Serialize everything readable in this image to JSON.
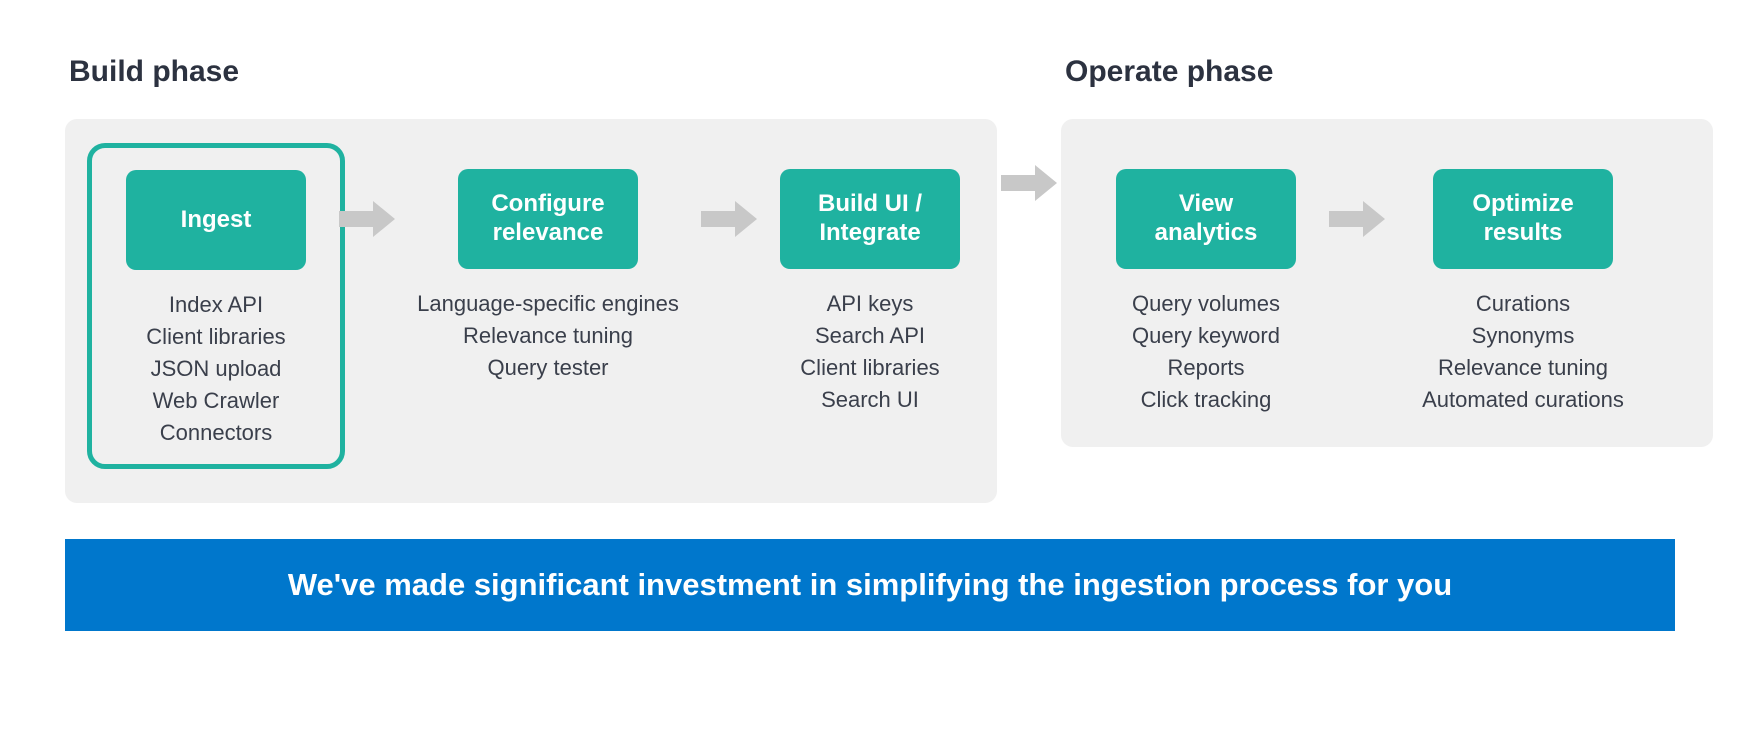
{
  "phases": {
    "build": {
      "title": "Build phase",
      "steps": [
        {
          "label": "Ingest",
          "highlighted": true,
          "items": [
            "Index API",
            "Client libraries",
            "JSON upload",
            "Web Crawler",
            "Connectors"
          ]
        },
        {
          "label": "Configure relevance",
          "highlighted": false,
          "items": [
            "Language-specific engines",
            "Relevance tuning",
            "Query tester"
          ]
        },
        {
          "label": "Build UI / Integrate",
          "highlighted": false,
          "items": [
            "API keys",
            "Search API",
            "Client libraries",
            "Search UI"
          ]
        }
      ]
    },
    "operate": {
      "title": "Operate phase",
      "steps": [
        {
          "label": "View analytics",
          "highlighted": false,
          "items": [
            "Query volumes",
            "Query keyword",
            "Reports",
            "Click tracking"
          ]
        },
        {
          "label": "Optimize results",
          "highlighted": false,
          "items": [
            "Curations",
            "Synonyms",
            "Relevance tuning",
            "Automated curations"
          ]
        }
      ]
    }
  },
  "banner": "We've made significant investment in simplifying the ingestion process for you",
  "colors": {
    "accent": "#1fb2a0",
    "arrow": "#c8c8c8",
    "banner": "#0077cc",
    "panel": "#f0f0f0",
    "text": "#2c3240"
  }
}
